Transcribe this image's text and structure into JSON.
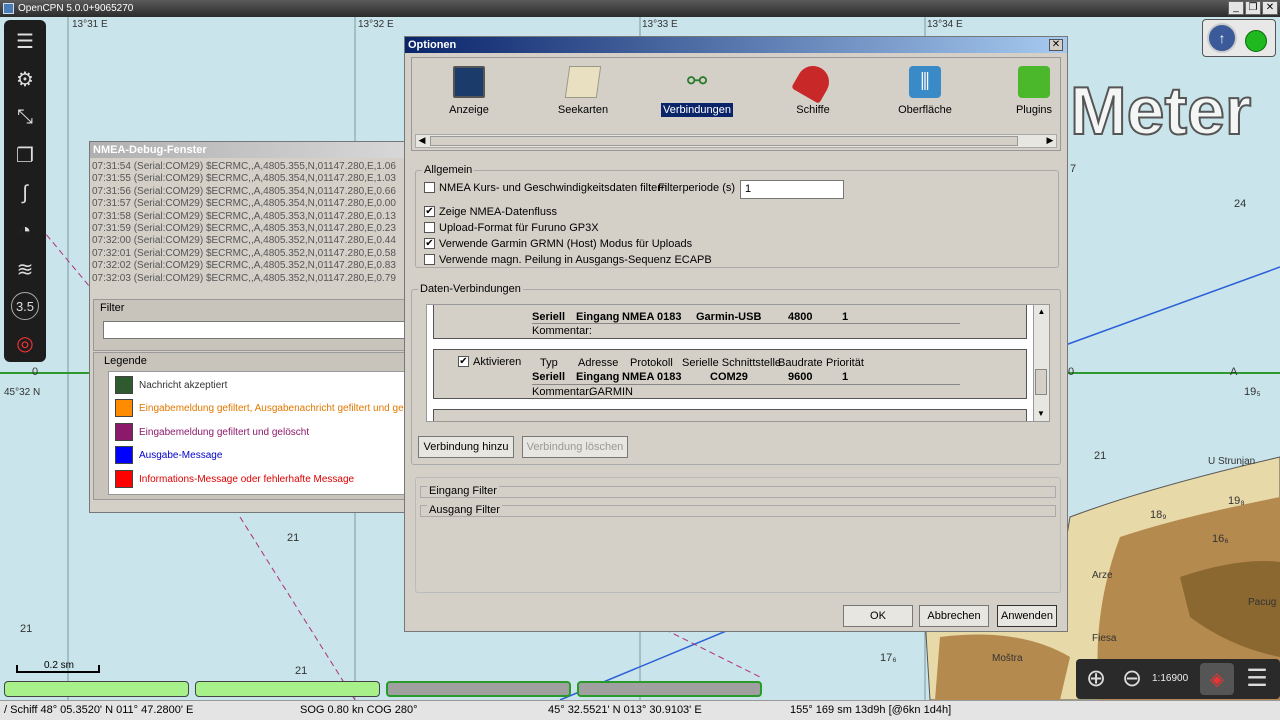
{
  "app": {
    "title": "OpenCPN 5.0.0+9065270"
  },
  "chart": {
    "lon_labels": [
      "13°31 E",
      "13°32 E",
      "13°33 E",
      "13°34 E"
    ],
    "lat_label": "45°32 N",
    "meter_text": "Meter",
    "depths": [
      "21",
      "21",
      "21",
      "21",
      "24",
      "7",
      "19₅",
      "21",
      "18₉",
      "19₈",
      "16₆",
      "17₆",
      "0",
      "0",
      "A"
    ],
    "places": [
      "U Strunjan",
      "Arze",
      "Fiesa",
      "Moštra",
      "Pacug"
    ],
    "scale_text": "0.2 sm",
    "zoom": "1:16900"
  },
  "nmea": {
    "title": "NMEA-Debug-Fenster",
    "lines": [
      "07:31:54 (Serial:COM29) $ECRMC,,A,4805.355,N,01147.280,E,1.06",
      "07:31:55 (Serial:COM29) $ECRMC,,A,4805.354,N,01147.280,E,1.03",
      "07:31:56 (Serial:COM29) $ECRMC,,A,4805.354,N,01147.280,E,0.66",
      "07:31:57 (Serial:COM29) $ECRMC,,A,4805.354,N,01147.280,E,0.00",
      "07:31:58 (Serial:COM29) $ECRMC,,A,4805.353,N,01147.280,E,0.13",
      "07:31:59 (Serial:COM29) $ECRMC,,A,4805.353,N,01147.280,E,0.23",
      "07:32:00 (Serial:COM29) $ECRMC,,A,4805.352,N,01147.280,E,0.44",
      "07:32:01 (Serial:COM29) $ECRMC,,A,4805.352,N,01147.280,E,0.58",
      "07:32:02 (Serial:COM29) $ECRMC,,A,4805.352,N,01147.280,E,0.83",
      "07:32:03 (Serial:COM29) $ECRMC,,A,4805.352,N,01147.280,E,0.79"
    ],
    "filter_label": "Filter",
    "legend_label": "Legende",
    "legend": [
      {
        "text": "Nachricht akzeptiert",
        "color": "#2f5a2f",
        "text_color": "#333333"
      },
      {
        "text": "Eingabemeldung gefiltert, Ausgabenachricht gefiltert und ge",
        "color": "#ff8c00",
        "text_color": "#e07800"
      },
      {
        "text": "Eingabemeldung gefiltert und gelöscht",
        "color": "#8b1a6b",
        "text_color": "#8b1a6b"
      },
      {
        "text": "Ausgabe-Message",
        "color": "#0000ff",
        "text_color": "#0000cc"
      },
      {
        "text": "Informations-Message oder fehlerhafte Message",
        "color": "#ff0000",
        "text_color": "#dd0000"
      }
    ]
  },
  "options": {
    "title": "Optionen",
    "tabs": [
      "Anzeige",
      "Seekarten",
      "Verbindungen",
      "Schiffe",
      "Oberfläche",
      "Plugins"
    ],
    "active_tab": "Verbindungen",
    "general": {
      "label": "Allgemein",
      "nmea_filter": "NMEA Kurs- und Geschwindigkeitsdaten filtern",
      "filter_period_label": "Filterperiode (s)",
      "filter_period_value": "1",
      "show_nmea": "Zeige NMEA-Datenfluss",
      "furuno": "Upload-Format für Furuno GP3X",
      "garmin": "Verwende Garmin GRMN (Host) Modus für Uploads",
      "magnetic": "Verwende magn. Peilung in Ausgangs-Sequenz ECAPB"
    },
    "connections": {
      "label": "Daten-Verbindungen",
      "headers": {
        "enable": "Aktivieren",
        "type": "Typ",
        "address": "Adresse",
        "protocol": "Protokoll",
        "serial_port": "Serielle Schnittstelle",
        "baud": "Baudrate",
        "priority": "Priorität"
      },
      "comment_label": "Kommentar:",
      "rows": [
        {
          "type": "Seriell",
          "direction": "Eingang",
          "protocol": "NMEA 0183",
          "port": "Garmin-USB",
          "baud": "4800",
          "priority": "1",
          "comment": ""
        },
        {
          "type": "Seriell",
          "direction": "Eingang",
          "protocol": "NMEA 0183",
          "port": "COM29",
          "baud": "9600",
          "priority": "1",
          "comment": "GARMIN"
        }
      ],
      "add_button": "Verbindung hinzu",
      "delete_button": "Verbindung löschen"
    },
    "input_filter": "Eingang Filter",
    "output_filter": "Ausgang Filter",
    "ok": "OK",
    "cancel": "Abbrechen",
    "apply": "Anwenden"
  },
  "status": {
    "ship": "/ Schiff 48° 05.3520' N   011° 47.2800' E",
    "sog_cog": "SOG 0.80 kn  COG 280°",
    "cursor": "45° 32.5521' N   013° 30.9103' E",
    "range": "155°  169 sm 13d9h [@6kn 1d4h]"
  },
  "colors": {
    "accent": "#0a246a",
    "land": "#b58a4e",
    "piano_active": "#a8f08a",
    "piano_inactive": "#a0a0a0"
  }
}
